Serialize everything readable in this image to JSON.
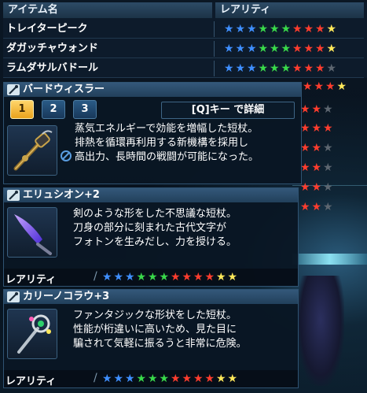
{
  "colors": {
    "star_blue": "#3f8fff",
    "star_green": "#39d84a",
    "star_red": "#ff3d2e",
    "star_yellow": "#ffe85a",
    "star_gray": "#5d6670"
  },
  "list": {
    "header_name": "アイテム名",
    "header_rarity": "レアリティ",
    "rows": [
      {
        "name": "トレイターピーク",
        "stars": [
          "blue",
          "blue",
          "blue",
          "green",
          "green",
          "green",
          "red",
          "red",
          "red",
          "yellow"
        ]
      },
      {
        "name": "ダガッチャウォンド",
        "stars": [
          "blue",
          "blue",
          "blue",
          "green",
          "green",
          "green",
          "red",
          "red",
          "red",
          "yellow"
        ]
      },
      {
        "name": "ラムダサルバドール",
        "stars": [
          "blue",
          "blue",
          "blue",
          "green",
          "green",
          "green",
          "red",
          "red",
          "red",
          "gray"
        ]
      }
    ]
  },
  "behind_rows": [
    [
      "red",
      "red",
      "red",
      "yellow"
    ],
    [
      "red",
      "red",
      "gray"
    ],
    [
      "red",
      "red",
      "red"
    ],
    [
      "red",
      "red",
      "gray"
    ],
    [
      "red",
      "red",
      "gray"
    ],
    [
      "red",
      "red",
      "gray"
    ],
    [
      "red",
      "red",
      "gray"
    ]
  ],
  "tooltip1": {
    "title": "バードウィスラー",
    "tabs": [
      "1",
      "2",
      "3"
    ],
    "hint": "[Q]キー で詳細",
    "desc": [
      "蒸気エネルギーで効能を増幅した短杖。",
      "排熱を循環再利用する新機構を採用し",
      "高出力、長時間の戦闘が可能になった。"
    ]
  },
  "tooltip2": {
    "title": "エリュシオン+2",
    "desc": [
      "剣のような形をした不思議な短杖。",
      "刀身の部分に刻まれた古代文字が",
      "フォトンを生みだし、力を授ける。"
    ],
    "rarity_label": "レアリティ",
    "stars": [
      "blue",
      "blue",
      "blue",
      "green",
      "green",
      "green",
      "red",
      "red",
      "red",
      "red",
      "yellow",
      "yellow"
    ]
  },
  "tooltip3": {
    "title": "カリーノコラウ+3",
    "desc": [
      "ファンタジックな形状をした短杖。",
      "性能が桁違いに高いため、見た目に",
      "騙されて気軽に振るうと非常に危険。"
    ],
    "rarity_label": "レアリティ",
    "stars": [
      "blue",
      "blue",
      "blue",
      "green",
      "green",
      "green",
      "red",
      "red",
      "red",
      "red",
      "yellow",
      "yellow"
    ]
  }
}
